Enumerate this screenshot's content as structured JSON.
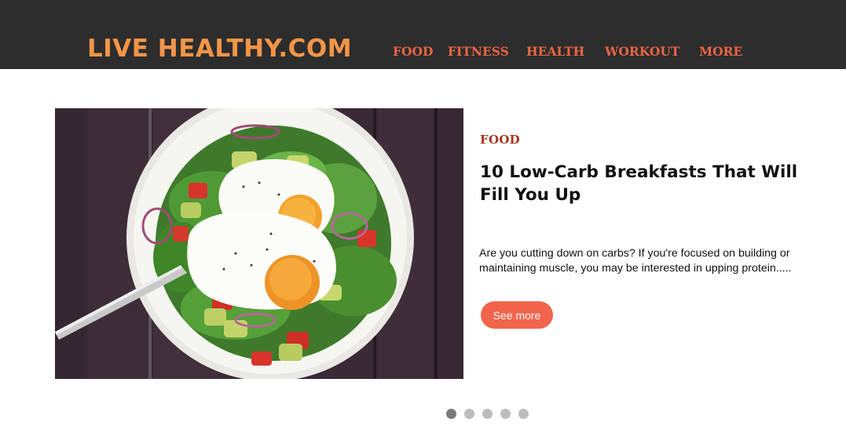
{
  "header": {
    "logo": "LIVE HEALTHY.COM",
    "nav": [
      "FOOD",
      "FITNESS",
      "HEALTH",
      "WORKOUT",
      "MORE"
    ]
  },
  "slide": {
    "category": "FOOD",
    "headline": "10 Low-Carb Breakfasts That Will Fill You Up",
    "excerpt": "Are you cutting down on carbs? If you're focused on building or maintaining muscle, you may be interested in upping protein.....",
    "button_label": "See more",
    "image_icon": "salad-with-fried-eggs-image"
  },
  "carousel": {
    "slide_count": 5,
    "active_index": 0
  },
  "colors": {
    "header_bg": "#2d2d2d",
    "logo": "#f39548",
    "nav": "#ec6444",
    "category": "#a3351c",
    "button": "#f0654b"
  }
}
